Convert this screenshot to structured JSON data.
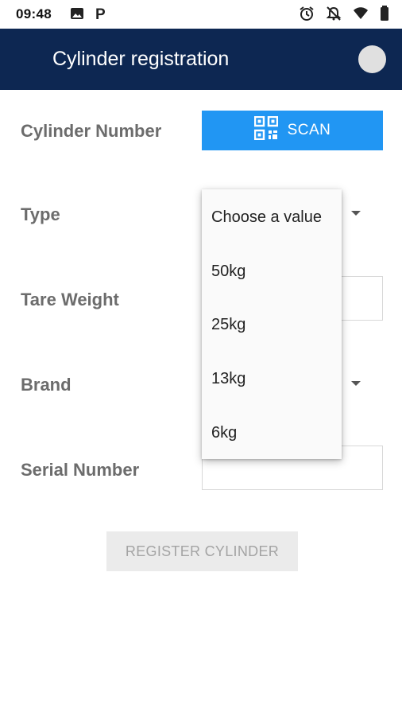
{
  "status_bar": {
    "time": "09:48",
    "icons": [
      "image-icon",
      "parking-icon",
      "alarm-icon",
      "notifications-off-icon",
      "wifi-icon",
      "battery-icon"
    ]
  },
  "app_bar": {
    "title": "Cylinder registration",
    "avatar_color": "#e0e0e0",
    "background": "#0d2752"
  },
  "form": {
    "cylinder_number_label": "Cylinder Number",
    "scan_label": "SCAN",
    "type_label": "Type",
    "tare_weight_label": "Tare Weight",
    "brand_label": "Brand",
    "serial_number_label": "Serial Number",
    "register_label": "REGISTER CYLINDER"
  },
  "type_dropdown_menu": {
    "items": [
      "Choose a value",
      "50kg",
      "25kg",
      "13kg",
      "6kg"
    ]
  },
  "colors": {
    "accent": "#2196f3",
    "label": "#6c6c6c",
    "disabled_button": "#ebebeb"
  }
}
